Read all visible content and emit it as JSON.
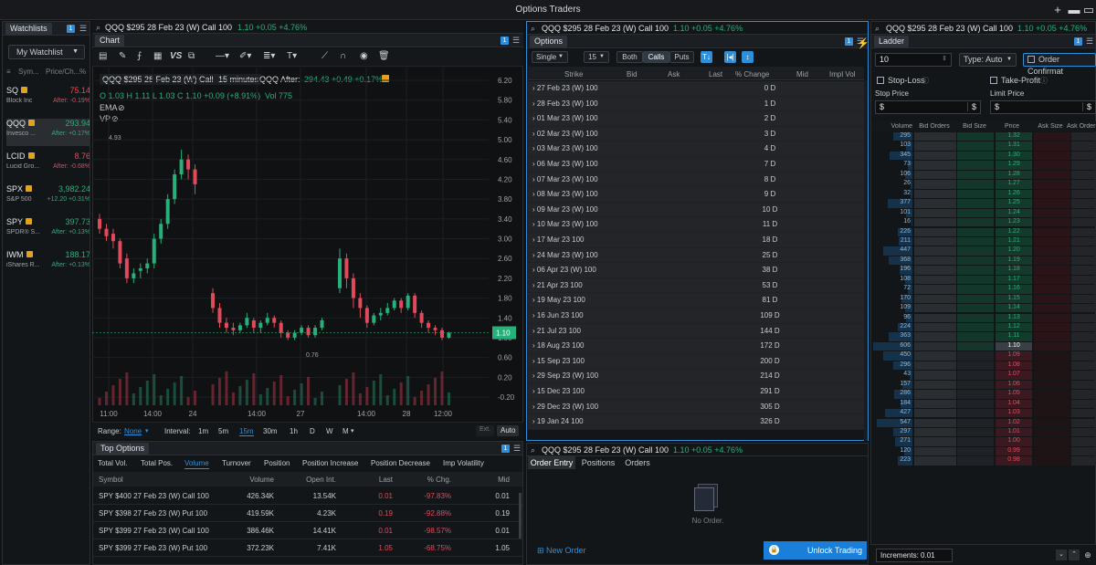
{
  "app_title": "Options Traders",
  "watchlists": {
    "tab": "Watchlists",
    "list_name": "My Watchlist",
    "col_symbol": "Sym...",
    "col_price": "Price/Ch...",
    "col_pct": "%",
    "rows": [
      {
        "symbol": "SQ",
        "price": "75.14",
        "name": "Block Inc",
        "change": "After: -0.19%"
      },
      {
        "symbol": "QQQ",
        "price": "293.94",
        "name": "Invesco ...",
        "change": "After: +0.17%"
      },
      {
        "symbol": "LCID",
        "price": "8.76",
        "name": "Lucid Gro...",
        "change": "After: -0.68%"
      },
      {
        "symbol": "SPX",
        "price": "3,982.24",
        "name": "S&P 500",
        "change": "+12.20 +0.31%"
      },
      {
        "symbol": "SPY",
        "price": "397.73",
        "name": "SPDR® S...",
        "change": "After: +0.13%"
      },
      {
        "symbol": "IWM",
        "price": "188.17",
        "name": "iShares R...",
        "change": "After: +0.13%"
      }
    ]
  },
  "contract": {
    "label": "QQQ $295 28 Feb 23 (W) Call 100",
    "quote": "1.10 +0.05 +4.76%"
  },
  "chart": {
    "tab": "Chart",
    "legend_symbol": "QQQ $295 28 Feb 23 (W) Call 100",
    "interval_label": "15 minutes",
    "after_label": "QQQ  After:",
    "after_value": "294.43 +0.49 +0.17%",
    "ohlc": "O 1.03  H 1.11  L 1.03  C 1.10 +0.09 (+8.91%)",
    "vol": "Vol 775",
    "ema": "EMA",
    "vp": "VP",
    "high_mark": "4.93",
    "low_mark": "0.76",
    "current_price": "1.10",
    "range_label": "Range:",
    "range_value": "None",
    "interval_title": "Interval:",
    "intervals": [
      "1m",
      "5m",
      "15m",
      "30m",
      "1h",
      "D",
      "W",
      "M"
    ],
    "ext": "Ext.",
    "auto": "Auto"
  },
  "chart_data": {
    "type": "candlestick",
    "y_ticks": [
      "6.20",
      "5.80",
      "5.40",
      "5.00",
      "4.60",
      "4.20",
      "3.80",
      "3.40",
      "3.00",
      "2.60",
      "2.20",
      "1.80",
      "1.40",
      "1.00",
      "0.60",
      "0.20",
      "-0.20"
    ],
    "x_ticks": [
      "11:00",
      "14:00",
      "24",
      "14:00",
      "27",
      "14:00",
      "28",
      "12:00"
    ],
    "ylim": [
      -0.2,
      6.2
    ]
  },
  "options": {
    "tab": "Options",
    "mode": "Single",
    "strikes": "15",
    "both": "Both",
    "calls": "Calls",
    "puts": "Puts",
    "cols": [
      "Strike",
      "Bid",
      "Ask",
      "Last",
      "% Change",
      "Mid",
      "Impl Vol"
    ],
    "expirations": [
      {
        "date": "27 Feb 23 (W) 100",
        "dte": "0 D"
      },
      {
        "date": "28 Feb 23 (W) 100",
        "dte": "1 D"
      },
      {
        "date": "01 Mar 23 (W) 100",
        "dte": "2 D"
      },
      {
        "date": "02 Mar 23 (W) 100",
        "dte": "3 D"
      },
      {
        "date": "03 Mar 23 (W) 100",
        "dte": "4 D"
      },
      {
        "date": "06 Mar 23 (W) 100",
        "dte": "7 D"
      },
      {
        "date": "07 Mar 23 (W) 100",
        "dte": "8 D"
      },
      {
        "date": "08 Mar 23 (W) 100",
        "dte": "9 D"
      },
      {
        "date": "09 Mar 23 (W) 100",
        "dte": "10 D"
      },
      {
        "date": "10 Mar 23 (W) 100",
        "dte": "11 D"
      },
      {
        "date": "17 Mar 23 100",
        "dte": "18 D"
      },
      {
        "date": "24 Mar 23 (W) 100",
        "dte": "25 D"
      },
      {
        "date": "06 Apr 23 (W) 100",
        "dte": "38 D"
      },
      {
        "date": "21 Apr 23 100",
        "dte": "53 D"
      },
      {
        "date": "19 May 23 100",
        "dte": "81 D"
      },
      {
        "date": "16 Jun 23 100",
        "dte": "109 D"
      },
      {
        "date": "21 Jul 23 100",
        "dte": "144 D"
      },
      {
        "date": "18 Aug 23 100",
        "dte": "172 D"
      },
      {
        "date": "15 Sep 23 100",
        "dte": "200 D"
      },
      {
        "date": "29 Sep 23 (W) 100",
        "dte": "214 D"
      },
      {
        "date": "15 Dec 23 100",
        "dte": "291 D"
      },
      {
        "date": "29 Dec 23 (W) 100",
        "dte": "305 D"
      },
      {
        "date": "19 Jan 24 100",
        "dte": "326 D"
      }
    ]
  },
  "top_options": {
    "tab": "Top Options",
    "filters": [
      "Total Vol.",
      "Total Pos.",
      "Volume",
      "Turnover",
      "Position",
      "Position Increase",
      "Position Decrease",
      "Imp Volatility"
    ],
    "cols": [
      "Symbol",
      "Volume",
      "Open Int.",
      "Last",
      "% Chg.",
      "Mid"
    ],
    "rows": [
      {
        "symbol": "SPY $400 27 Feb 23 (W) Call 100",
        "volume": "426.34K",
        "oi": "13.54K",
        "last": "0.01",
        "chg": "-97.83%",
        "mid": "0.01"
      },
      {
        "symbol": "SPY $398 27 Feb 23 (W) Put 100",
        "volume": "419.59K",
        "oi": "4.23K",
        "last": "0.19",
        "chg": "-92.88%",
        "mid": "0.19"
      },
      {
        "symbol": "SPY $399 27 Feb 23 (W) Call 100",
        "volume": "386.46K",
        "oi": "14.41K",
        "last": "0.01",
        "chg": "-98.57%",
        "mid": "0.01"
      },
      {
        "symbol": "SPY $399 27 Feb 23 (W) Put 100",
        "volume": "372.23K",
        "oi": "7.41K",
        "last": "1.05",
        "chg": "-68.75%",
        "mid": "1.05"
      }
    ]
  },
  "order_entry": {
    "tabs": [
      "Order Entry",
      "Positions",
      "Orders"
    ],
    "empty": "No Order.",
    "new_order": "New Order",
    "unlock": "Unlock Trading"
  },
  "ladder": {
    "tab": "Ladder",
    "qty": "10",
    "type": "Type: Auto",
    "confirm": "Order Confirmat",
    "stop_loss": "Stop-Loss",
    "take_profit": "Take-Profit",
    "stop_price": "Stop Price",
    "limit_price": "Limit Price",
    "cols": [
      "Volume",
      "Bid Orders",
      "Bid Size",
      "Price",
      "Ask Size",
      "Ask Orders"
    ],
    "increments": "Increments: 0.01",
    "rows": [
      {
        "vol": "295",
        "price": "1.32"
      },
      {
        "vol": "103",
        "price": "1.31"
      },
      {
        "vol": "345",
        "price": "1.30"
      },
      {
        "vol": "73",
        "price": "1.29"
      },
      {
        "vol": "106",
        "price": "1.28"
      },
      {
        "vol": "26",
        "price": "1.27"
      },
      {
        "vol": "32",
        "price": "1.26"
      },
      {
        "vol": "377",
        "price": "1.25"
      },
      {
        "vol": "101",
        "price": "1.24"
      },
      {
        "vol": "16",
        "price": "1.23"
      },
      {
        "vol": "226",
        "price": "1.22"
      },
      {
        "vol": "211",
        "price": "1.21"
      },
      {
        "vol": "447",
        "price": "1.20"
      },
      {
        "vol": "368",
        "price": "1.19"
      },
      {
        "vol": "196",
        "price": "1.18"
      },
      {
        "vol": "108",
        "price": "1.17"
      },
      {
        "vol": "72",
        "price": "1.16"
      },
      {
        "vol": "170",
        "price": "1.15"
      },
      {
        "vol": "109",
        "price": "1.14"
      },
      {
        "vol": "96",
        "price": "1.13"
      },
      {
        "vol": "224",
        "price": "1.12"
      },
      {
        "vol": "363",
        "price": "1.11"
      },
      {
        "vol": "606",
        "price": "1.10"
      },
      {
        "vol": "450",
        "price": "1.09"
      },
      {
        "vol": "296",
        "price": "1.08"
      },
      {
        "vol": "43",
        "price": "1.07"
      },
      {
        "vol": "157",
        "price": "1.06"
      },
      {
        "vol": "286",
        "price": "1.05"
      },
      {
        "vol": "184",
        "price": "1.04"
      },
      {
        "vol": "427",
        "price": "1.03"
      },
      {
        "vol": "547",
        "price": "1.02"
      },
      {
        "vol": "297",
        "price": "1.01"
      },
      {
        "vol": "271",
        "price": "1.00"
      },
      {
        "vol": "120",
        "price": "0.99"
      },
      {
        "vol": "223",
        "price": "0.98"
      }
    ]
  },
  "colors": {
    "green": "#27b07a",
    "red": "#e04a5b",
    "accent": "#2f8fd8",
    "badge": "#e3a21a"
  }
}
